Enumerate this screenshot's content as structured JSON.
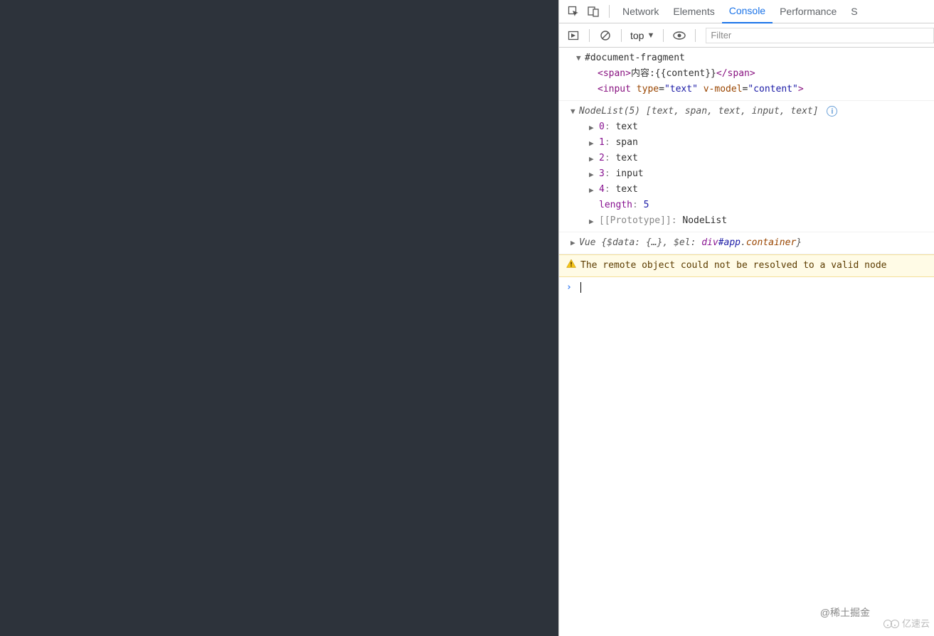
{
  "tabs": {
    "network": "Network",
    "elements": "Elements",
    "console": "Console",
    "performance": "Performance",
    "sources_initial": "S"
  },
  "toolbar": {
    "context": "top",
    "filter_placeholder": "Filter"
  },
  "log": {
    "docfrag": "#document-fragment",
    "span_open": "<span>",
    "span_text": "内容:{{content}}",
    "span_close": "</span>",
    "input_open": "<input",
    "input_type_attr": "type",
    "input_type_eq": "=",
    "input_type_val": "\"text\"",
    "input_vmodel_attr": "v-model",
    "input_vmodel_eq": "=",
    "input_vmodel_val": "\"content\"",
    "input_close": ">",
    "nodelist_label": "NodeList(5)",
    "nodelist_open": " [",
    "nodelist_close": "]",
    "nl_items": [
      "text",
      "span",
      "text",
      "input",
      "text"
    ],
    "entries": [
      {
        "k": "0",
        "v": "text"
      },
      {
        "k": "1",
        "v": "span"
      },
      {
        "k": "2",
        "v": "text"
      },
      {
        "k": "3",
        "v": "input"
      },
      {
        "k": "4",
        "v": "text"
      }
    ],
    "length_key": "length",
    "length_val": "5",
    "proto_key": "[[Prototype]]",
    "proto_val": "NodeList",
    "vue_label": "Vue",
    "vue_open": " {",
    "vue_data_key": "$data",
    "vue_data_val": "{…}",
    "vue_el_key": "$el",
    "vue_el_div": "div",
    "vue_el_id": "#app",
    "vue_el_dot": ".",
    "vue_el_class": "container",
    "vue_close": "}"
  },
  "warning": "The remote object could not be resolved to a valid node",
  "watermarks": {
    "w1": "@稀土掘金",
    "w2": "亿速云"
  }
}
